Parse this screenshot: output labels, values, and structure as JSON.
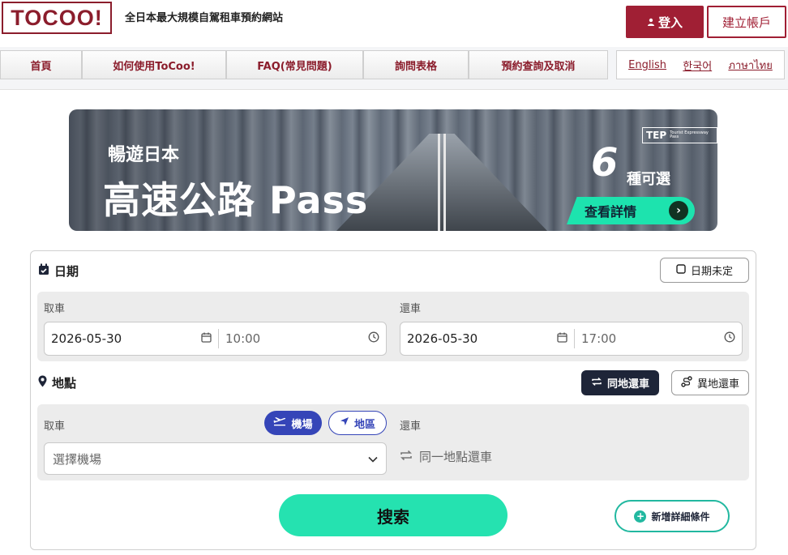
{
  "header": {
    "logo": "TOCOO!",
    "tagline": "全日本最大規模自駕租車預約網站",
    "login_label": "登入",
    "register_label": "建立帳戶"
  },
  "nav": {
    "items": [
      {
        "label": "首頁"
      },
      {
        "label": "如何使用ToCoo!"
      },
      {
        "label": "FAQ(常見問題)"
      },
      {
        "label": "詢問表格"
      },
      {
        "label": "預約查詢及取消"
      }
    ],
    "languages": [
      "English",
      "한국어",
      "ภาษาไทย"
    ]
  },
  "banner": {
    "subtitle": "暢遊日本",
    "title": "高速公路 Pass",
    "badge": "TEP",
    "badge_small": "Tourist Expressway Pass",
    "count": "6",
    "count_text": "種可選",
    "cta": "查看詳情"
  },
  "form": {
    "date": {
      "title": "日期",
      "undecided_label": "日期未定",
      "pickup_label": "取車",
      "return_label": "還車",
      "pickup_date": "2026-05-30",
      "pickup_time": "10:00",
      "return_date": "2026-05-30",
      "return_time": "17:00"
    },
    "location": {
      "title": "地點",
      "same_return_label": "同地還車",
      "diff_return_label": "異地還車",
      "pickup_label": "取車",
      "return_label": "還車",
      "airport_label": "機場",
      "area_label": "地區",
      "select_placeholder": "選擇機場",
      "return_same_text": "同一地點還車"
    },
    "search_label": "搜索",
    "more_conditions_label": "新增詳細條件"
  },
  "colors": {
    "brand": "#a01f34",
    "accent": "#25e2b0",
    "blue": "#3545b8",
    "dark": "#1e2538"
  }
}
